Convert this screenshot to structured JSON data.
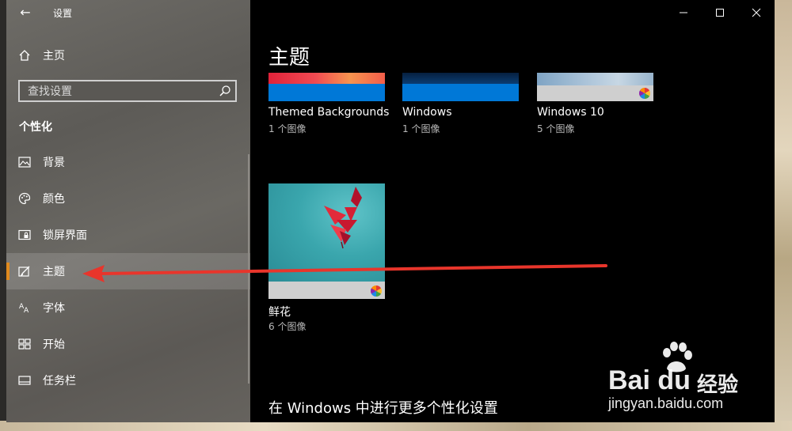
{
  "window": {
    "app_title": "设置",
    "back_symbol": "←",
    "controls": {
      "minimize": "—",
      "maximize": "☐",
      "close": "✕"
    }
  },
  "sidebar": {
    "home_label": "主页",
    "search_placeholder": "查找设置",
    "section_title": "个性化",
    "items": [
      {
        "label": "背景",
        "icon": "picture-icon"
      },
      {
        "label": "颜色",
        "icon": "palette-icon"
      },
      {
        "label": "锁屏界面",
        "icon": "lock-screen-icon"
      },
      {
        "label": "主题",
        "icon": "theme-brush-icon",
        "active": true
      },
      {
        "label": "字体",
        "icon": "font-icon"
      },
      {
        "label": "开始",
        "icon": "start-tiles-icon"
      },
      {
        "label": "任务栏",
        "icon": "taskbar-icon"
      }
    ],
    "accent_color": "#e08a1e"
  },
  "main": {
    "page_title": "主题",
    "themes": [
      {
        "name": "Themed Backgrounds",
        "count": "1 个图像"
      },
      {
        "name": "Windows",
        "count": "1 个图像"
      },
      {
        "name": "Windows 10",
        "count": "5 个图像"
      },
      {
        "name": "鲜花",
        "count": "6 个图像"
      }
    ],
    "more_settings": "在 Windows 中进行更多个性化设置"
  },
  "watermark": {
    "logo": "Bai du",
    "cn": "经验",
    "url": "jingyan.baidu.com"
  },
  "colors": {
    "annotation_arrow": "#e8352b",
    "windows_blue": "#0078d7"
  }
}
